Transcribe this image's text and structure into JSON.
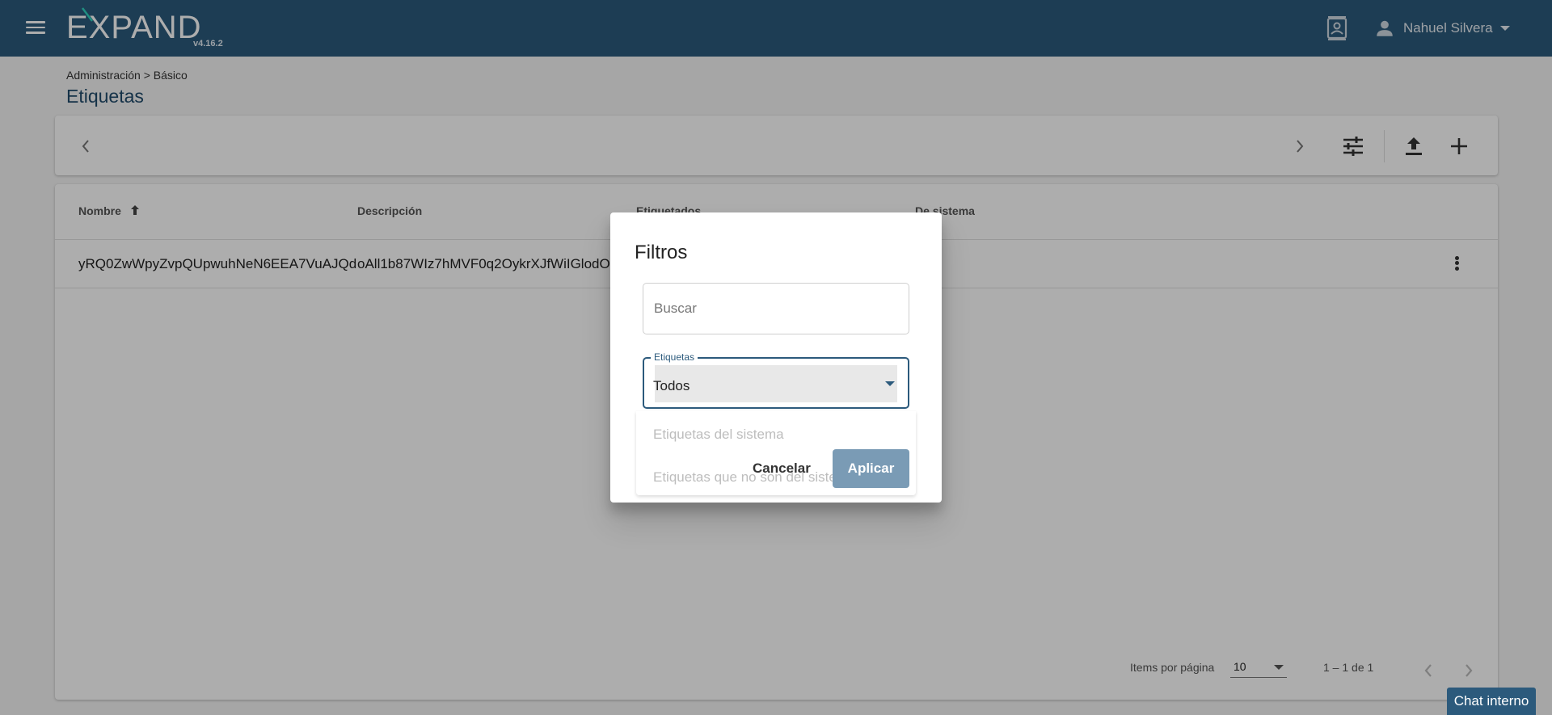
{
  "header": {
    "logo_text": "EXPAND",
    "version": "v4.16.2",
    "user_name": "Nahuel Silvera"
  },
  "page": {
    "breadcrumb": "Administración > Básico",
    "title": "Etiquetas"
  },
  "table": {
    "columns": [
      "Nombre",
      "Descripción",
      "Etiquetados",
      "De sistema"
    ],
    "sort_column": "Nombre",
    "sort_direction": "asc",
    "rows": [
      {
        "nombre": "yRQ0ZwWpyZvpQUpwuhNeN6EEA7VuAJQd",
        "descripcion": "oAll1b87WIz7hMVF0q2OykrXJfWiIGlodO",
        "etiquetados": "",
        "de_sistema": ""
      }
    ]
  },
  "paginator": {
    "items_label": "Items por página",
    "page_size": "10",
    "range_label": "1 – 1 de 1"
  },
  "dialog": {
    "title": "Filtros",
    "search_placeholder": "Buscar",
    "search_value": "",
    "select_label": "Etiquetas",
    "select_value": "Todos",
    "options": [
      "Etiquetas del sistema",
      "Etiquetas que no son del sistema"
    ],
    "cancel_label": "Cancelar",
    "apply_label": "Aplicar"
  },
  "chat": {
    "label": "Chat interno"
  },
  "colors": {
    "primary": "#2c5a7c",
    "apply_button": "#7a9bb5",
    "backdrop": "rgba(0,0,0,0.32)"
  },
  "icons": {
    "menu": "menu-icon",
    "contact": "contact-card-icon",
    "user": "person-icon",
    "user_caret": "chevron-down-icon",
    "prev": "chevron-left-icon",
    "next": "chevron-right-icon",
    "filter": "tune-icon",
    "upload": "upload-icon",
    "add": "plus-icon",
    "sort": "arrow-up-icon",
    "row_menu": "more-vert-icon"
  }
}
